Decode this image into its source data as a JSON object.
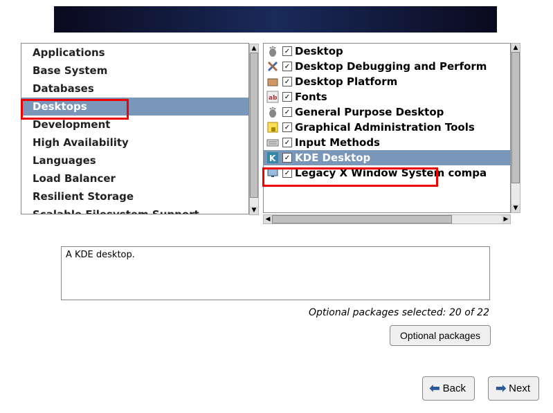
{
  "categories": [
    {
      "label": "Applications",
      "selected": false
    },
    {
      "label": "Base System",
      "selected": false
    },
    {
      "label": "Databases",
      "selected": false
    },
    {
      "label": "Desktops",
      "selected": true
    },
    {
      "label": "Development",
      "selected": false
    },
    {
      "label": "High Availability",
      "selected": false
    },
    {
      "label": "Languages",
      "selected": false
    },
    {
      "label": "Load Balancer",
      "selected": false
    },
    {
      "label": "Resilient Storage",
      "selected": false
    },
    {
      "label": "Scalable Filesystem Support",
      "selected": false
    }
  ],
  "packages": [
    {
      "label": "Desktop",
      "checked": true,
      "selected": false,
      "icon": "foot"
    },
    {
      "label": "Desktop Debugging and Perform",
      "checked": true,
      "selected": false,
      "icon": "tools"
    },
    {
      "label": "Desktop Platform",
      "checked": true,
      "selected": false,
      "icon": "box"
    },
    {
      "label": "Fonts",
      "checked": true,
      "selected": false,
      "icon": "font"
    },
    {
      "label": "General Purpose Desktop",
      "checked": true,
      "selected": false,
      "icon": "foot"
    },
    {
      "label": "Graphical Administration Tools",
      "checked": true,
      "selected": false,
      "icon": "lock"
    },
    {
      "label": "Input Methods",
      "checked": true,
      "selected": false,
      "icon": "keyboard"
    },
    {
      "label": "KDE Desktop",
      "checked": true,
      "selected": true,
      "icon": "kde"
    },
    {
      "label": "Legacy X Window System compa",
      "checked": true,
      "selected": false,
      "icon": "monitor"
    }
  ],
  "description": "A KDE desktop.",
  "status": "Optional packages selected: 20 of 22",
  "buttons": {
    "optional": "Optional packages",
    "back": "Back",
    "next": "Next"
  }
}
